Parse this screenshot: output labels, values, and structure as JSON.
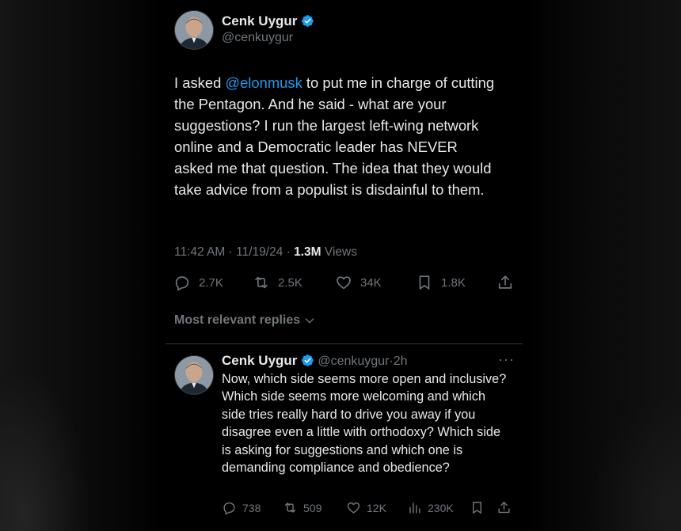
{
  "tweet": {
    "author_name": "Cenk Uygur",
    "author_handle": "@cenkuygur",
    "text_before_mention": "I asked ",
    "mention": "@elonmusk",
    "text_after_mention": " to put me in charge of cutting the Pentagon. And he said - what are your suggestions? I run the largest left-wing network online and a Democratic leader has NEVER asked me that question. The idea that they would take advice from a populist is disdainful to them.",
    "time": "11:42 AM",
    "date": "11/19/24",
    "views_count": "1.3M",
    "views_label": "Views",
    "separator": "·"
  },
  "actions": {
    "replies": "2.7K",
    "reposts": "2.5K",
    "likes": "34K",
    "bookmarks": "1.8K",
    "icons": [
      "reply-icon",
      "repost-icon",
      "like-icon",
      "bookmark-icon",
      "share-icon"
    ]
  },
  "replies_sort": {
    "label": "Most relevant replies"
  },
  "reply": {
    "author_name": "Cenk Uygur",
    "author_handle": "@cenkuygur",
    "time_ago": "2h",
    "separator": "·",
    "text": "Now, which side seems more open and inclusive? Which side seems more welcoming and which side tries really hard to drive you away if you disagree even a little with orthodoxy? Which side is asking for suggestions and which one is demanding compliance and obedience?",
    "more": "···",
    "replies": "738",
    "reposts": "509",
    "likes": "12K",
    "views": "230K"
  },
  "colors": {
    "background": "#000000",
    "text": "#e7e9ea",
    "secondary": "#71767b",
    "accent": "#1d9bf0",
    "divider": "#2f3336"
  }
}
